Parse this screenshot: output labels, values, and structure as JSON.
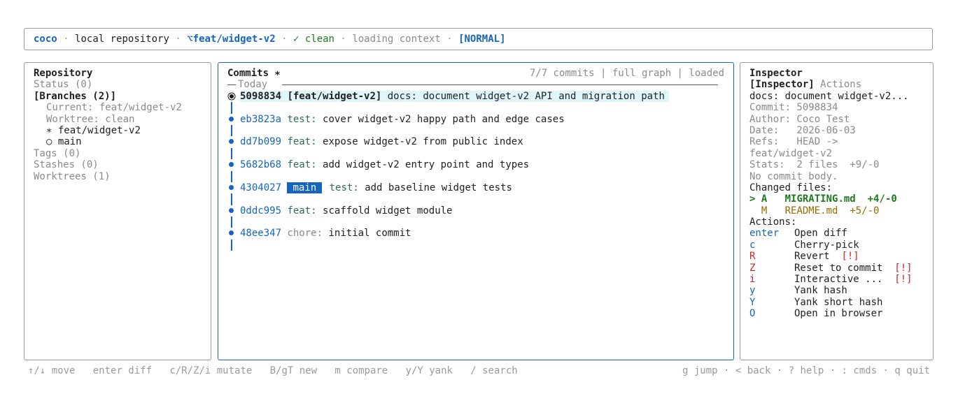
{
  "status_bar": {
    "app": "coco",
    "sep": "·",
    "repo": "local repository",
    "branch_icon": "branch-icon",
    "branch_glyph": "⌥",
    "branch": "feat/widget-v2",
    "clean_glyph": "✓",
    "clean": "clean",
    "context": "loading context",
    "mode": "[NORMAL]"
  },
  "repo_panel": {
    "title": "Repository",
    "status": "Status (0)",
    "branches": "[Branches (2)]",
    "current": "Current: feat/widget-v2",
    "worktree": "Worktree: clean",
    "branch_items": [
      {
        "marker": "∗",
        "name": "feat/widget-v2"
      },
      {
        "marker": "○",
        "name": "main"
      }
    ],
    "tags": "Tags (0)",
    "stashes": "Stashes (0)",
    "worktrees": "Worktrees (1)"
  },
  "commits_panel": {
    "title": "Commits ∗",
    "summary": "7/7 commits | full graph | loaded",
    "group": "Today",
    "commits": [
      {
        "hash": "5098834",
        "refs": "[feat/widget-v2]",
        "type": "docs:",
        "message": "document widget-v2 API and migration path"
      },
      {
        "hash": "eb3823a",
        "type": "test:",
        "message": "cover widget-v2 happy path and edge cases"
      },
      {
        "hash": "dd7b099",
        "type": "feat:",
        "message": "expose widget-v2 from public index"
      },
      {
        "hash": "5682b68",
        "type": "feat:",
        "message": "add widget-v2 entry point and types"
      },
      {
        "hash": "4304027",
        "badge": "main",
        "type": "test:",
        "message": "add baseline widget tests"
      },
      {
        "hash": "0ddc995",
        "type": "feat:",
        "message": "scaffold widget module"
      },
      {
        "hash": "48ee347",
        "type": "chore:",
        "message": "initial commit"
      }
    ]
  },
  "inspector": {
    "title": "Inspector",
    "tab_active": "[Inspector]",
    "tab_other": "Actions",
    "subject": "docs: document widget-v2...",
    "commit": "Commit: 5098834",
    "author": "Author: Coco Test",
    "date": "Date:   2026-06-03",
    "refs_1": "Refs:   HEAD ->",
    "refs_2": "feat/widget-v2",
    "stats": "Stats:  2 files  +9/-0",
    "body": "No commit body.",
    "changed_files_label": "Changed files:",
    "files": [
      {
        "prefix": "> A",
        "name": "MIGRATING.md",
        "delta": "+4/-0"
      },
      {
        "prefix": "  M",
        "name": "README.md",
        "delta": "+5/-0"
      }
    ],
    "actions_label": "Actions:",
    "actions": [
      {
        "key": "enter",
        "label": "Open diff",
        "warn": ""
      },
      {
        "key": "c",
        "label": "Cherry-pick",
        "warn": ""
      },
      {
        "key": "R",
        "label": "Revert",
        "warn": "[!]"
      },
      {
        "key": "Z",
        "label": "Reset to commit",
        "warn": "[!]"
      },
      {
        "key": "i",
        "label": "Interactive ...",
        "warn": "[!]"
      },
      {
        "key": "y",
        "label": "Yank hash",
        "warn": ""
      },
      {
        "key": "Y",
        "label": "Yank short hash",
        "warn": ""
      },
      {
        "key": "O",
        "label": "Open in browser",
        "warn": ""
      }
    ]
  },
  "footer": {
    "left": [
      "↑/↓ move",
      "enter diff",
      "c/R/Z/i mutate",
      "B/gT new",
      "m compare",
      "y/Y yank",
      "/ search"
    ],
    "right": "g jump · < back · ? help · : cmds · q quit"
  },
  "colors": {
    "accent": "#1565c0",
    "selected_row": "#dff6fb",
    "added": "#1e7a1e",
    "modified": "#9a6a00",
    "danger": "#c62828"
  }
}
